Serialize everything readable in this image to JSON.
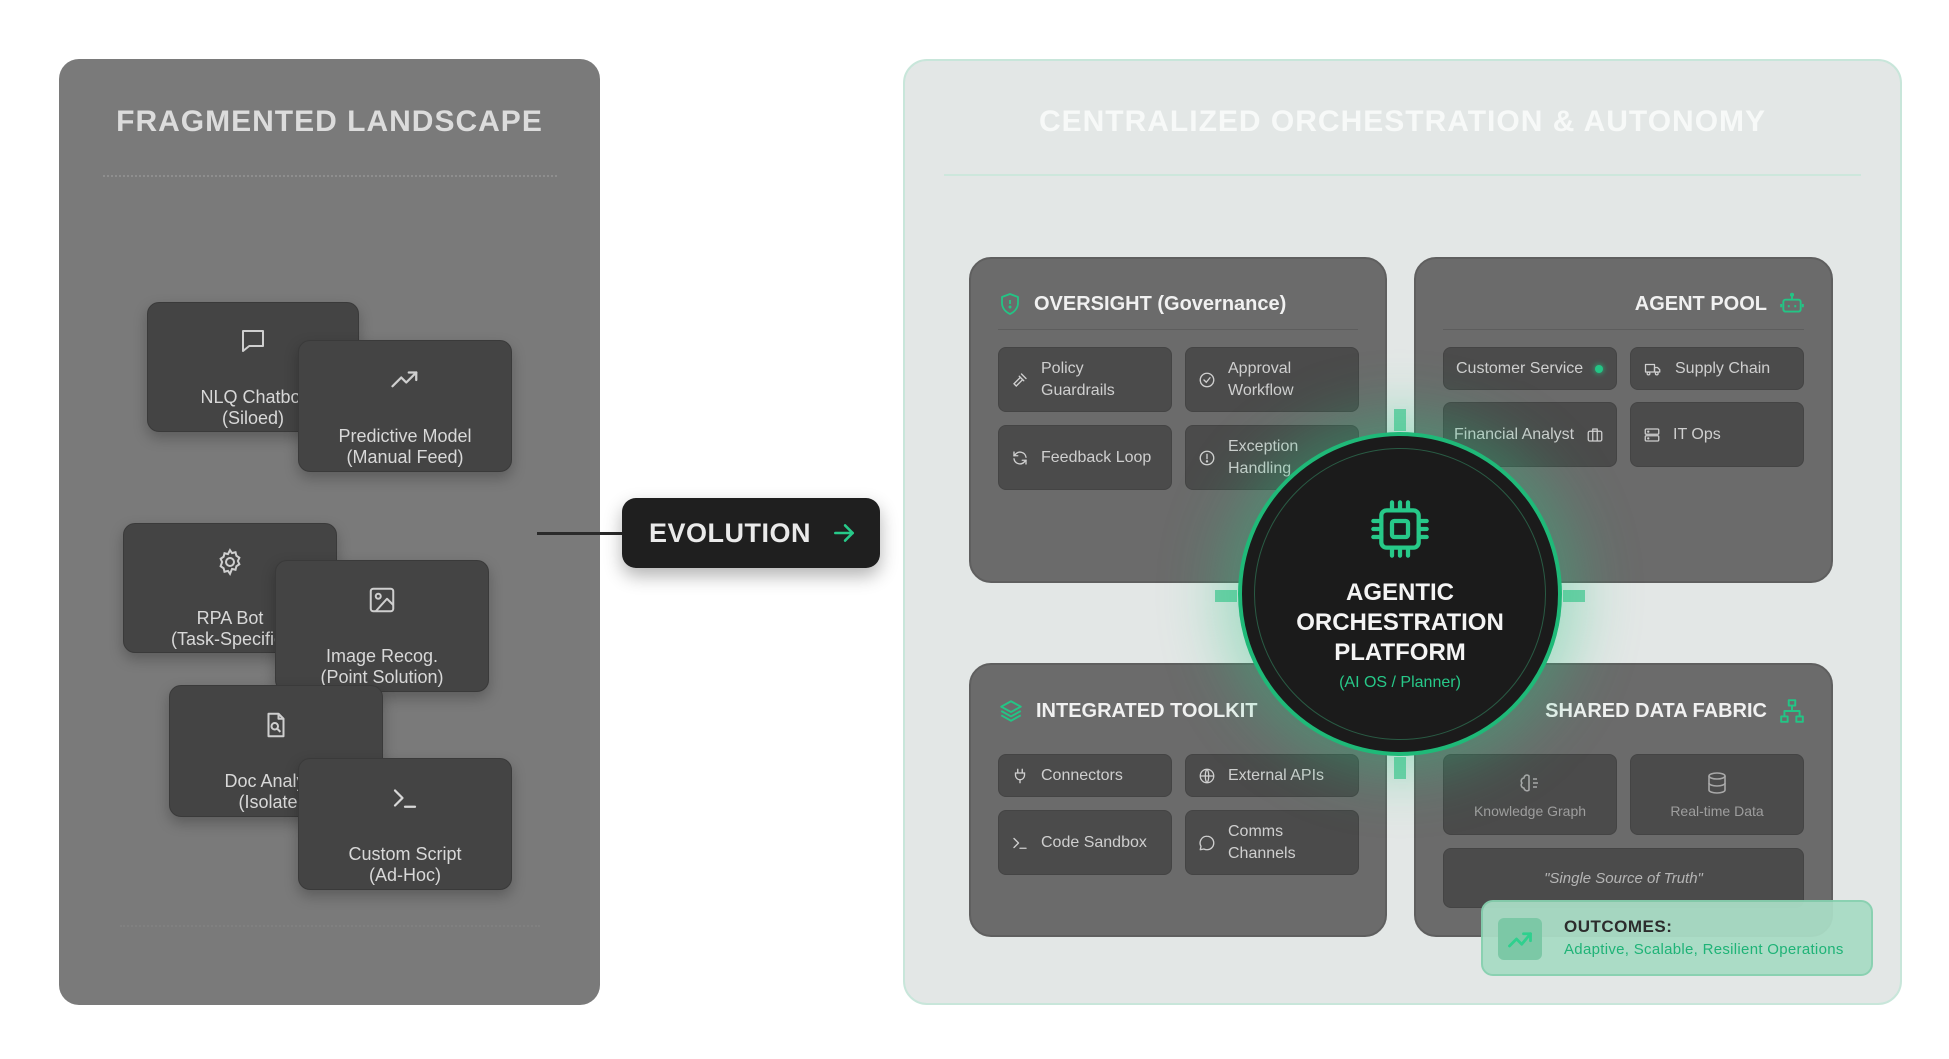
{
  "left": {
    "title": "FRAGMENTED LANDSCAPE",
    "tools": [
      {
        "label": "NLQ Chatbot\n(Siloed)",
        "icon": "chat-icon"
      },
      {
        "label": "Predictive Model\n(Manual Feed)",
        "icon": "trend-icon"
      },
      {
        "label": "RPA Bot\n(Task-Specific)",
        "icon": "gear-icon"
      },
      {
        "label": "Image Recog.\n(Point Solution)",
        "icon": "image-icon"
      },
      {
        "label": "Doc Analysis\n(Isolated)",
        "icon": "doc-search-icon"
      },
      {
        "label": "Custom Script\n(Ad-Hoc)",
        "icon": "terminal-icon"
      }
    ]
  },
  "evolution": {
    "label": "EVOLUTION",
    "icon": "arrow-right-icon"
  },
  "right": {
    "title": "CENTRALIZED ORCHESTRATION & AUTONOMY",
    "oversight": {
      "title": "OVERSIGHT (Governance)",
      "icon": "shield-icon",
      "items": [
        {
          "label": "Policy\nGuardrails",
          "icon": "gavel-icon"
        },
        {
          "label": "Approval\nWorkflow",
          "icon": "check-circle-icon"
        },
        {
          "label": "Feedback Loop",
          "icon": "refresh-icon"
        },
        {
          "label": "Exception\nHandling",
          "icon": "alert-circle-icon"
        }
      ]
    },
    "agent_pool": {
      "title": "AGENT POOL",
      "icon": "robot-icon",
      "items": [
        {
          "label": "Customer Service",
          "icon": "status-dot"
        },
        {
          "label": "Supply Chain",
          "icon": "truck-icon"
        },
        {
          "label": "Financial Analyst",
          "icon": "briefcase-icon"
        },
        {
          "label": "IT Ops",
          "icon": "server-icon"
        }
      ]
    },
    "toolkit": {
      "title": "INTEGRATED TOOLKIT",
      "icon": "layers-icon",
      "items": [
        {
          "label": "Connectors",
          "icon": "plug-icon"
        },
        {
          "label": "External APIs",
          "icon": "globe-icon"
        },
        {
          "label": "Code Sandbox",
          "icon": "terminal-icon"
        },
        {
          "label": "Comms\nChannels",
          "icon": "message-icon"
        }
      ]
    },
    "data_fabric": {
      "title": "SHARED DATA FABRIC",
      "icon": "network-icon",
      "items": [
        {
          "label": "Knowledge Graph",
          "icon": "brain-icon"
        },
        {
          "label": "Real-time Data",
          "icon": "database-icon"
        }
      ],
      "truth": "\"Single Source of Truth\""
    },
    "hub": {
      "title": "AGENTIC\nORCHESTRATION\nPLATFORM",
      "subtitle": "(AI OS / Planner)",
      "icon": "cpu-icon"
    },
    "outcomes": {
      "label": "OUTCOMES:",
      "text": "Adaptive, Scalable, Resilient Operations",
      "icon": "trending-up-icon"
    }
  },
  "colors": {
    "accent": "#1fb978",
    "dark": "#1f1f1f",
    "left_panel": "#7a7a7a",
    "right_panel": "#e3e7e6"
  }
}
